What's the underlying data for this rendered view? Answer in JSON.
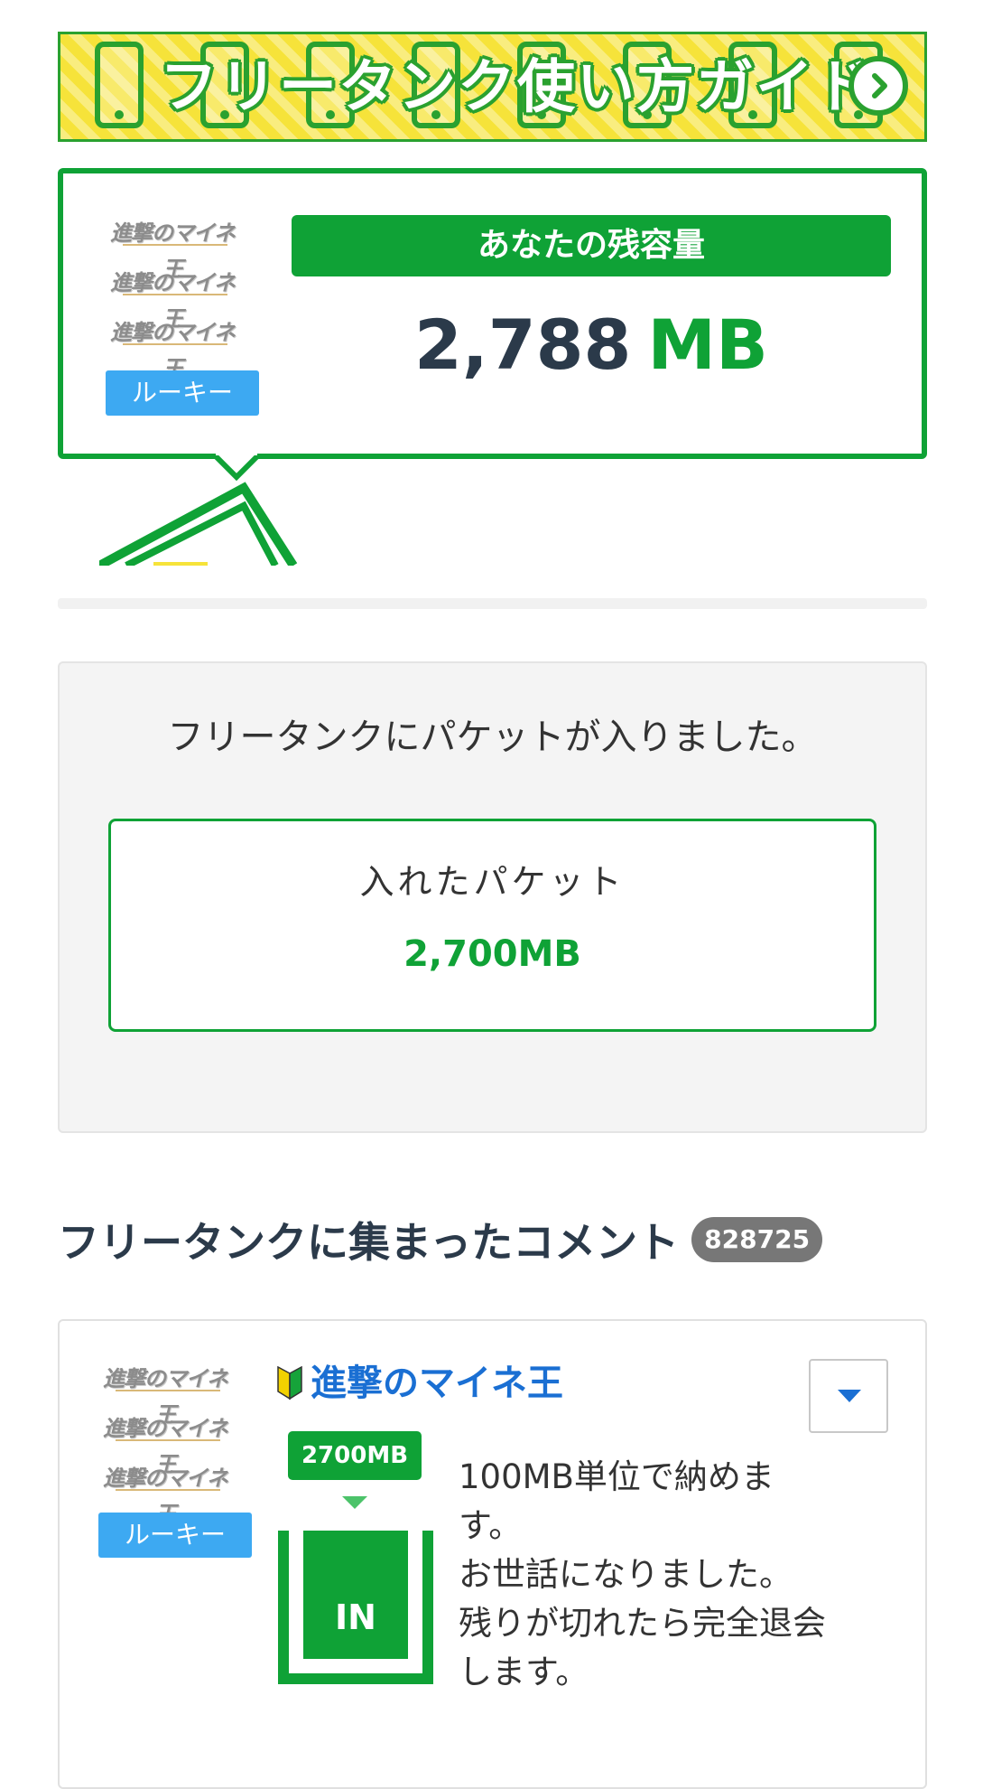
{
  "guide_banner": {
    "title": "フリータンク使い方ガイド"
  },
  "capacity": {
    "label": "あなたの残容量",
    "value": "2,788",
    "unit": "MB",
    "user_rank": "ルーキー"
  },
  "notice": {
    "message": "フリータンクにパケットが入りました。",
    "packet_label": "入れたパケット",
    "packet_value": "2,700MB"
  },
  "comments": {
    "title": "フリータンクに集まったコメント",
    "count": "828725",
    "items": [
      {
        "username": "進撃のマイネ王",
        "rank": "ルーキー",
        "amount": "2700MB",
        "direction": "IN",
        "text": "100MB単位で納めま\nす。\nお世話になりました。\n残りが切れたら完全退会\nします。"
      }
    ]
  },
  "colors": {
    "brand_green": "#0fa236",
    "banner_yellow": "#f6e33a",
    "rank_blue": "#3da9f2",
    "username_blue": "#1a6fd3"
  }
}
